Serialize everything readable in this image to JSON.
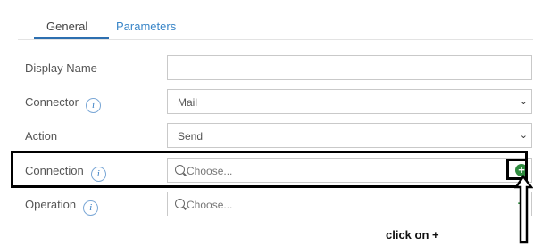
{
  "tabs": {
    "general": "General",
    "parameters": "Parameters"
  },
  "form": {
    "display_name": {
      "label": "Display Name",
      "value": ""
    },
    "connector": {
      "label": "Connector",
      "value": "Mail",
      "has_info": true
    },
    "action": {
      "label": "Action",
      "value": "Send"
    },
    "connection": {
      "label": "Connection",
      "placeholder": "Choose...",
      "has_info": true
    },
    "operation": {
      "label": "Operation",
      "placeholder": "Choose...",
      "has_info": true
    }
  },
  "icons": {
    "info": "i",
    "chevron": "⌄",
    "plus": "+"
  },
  "annotation": {
    "text": "click on +"
  },
  "colors": {
    "accent": "#2d6fb0",
    "plus_green": "#2e8b3e"
  }
}
